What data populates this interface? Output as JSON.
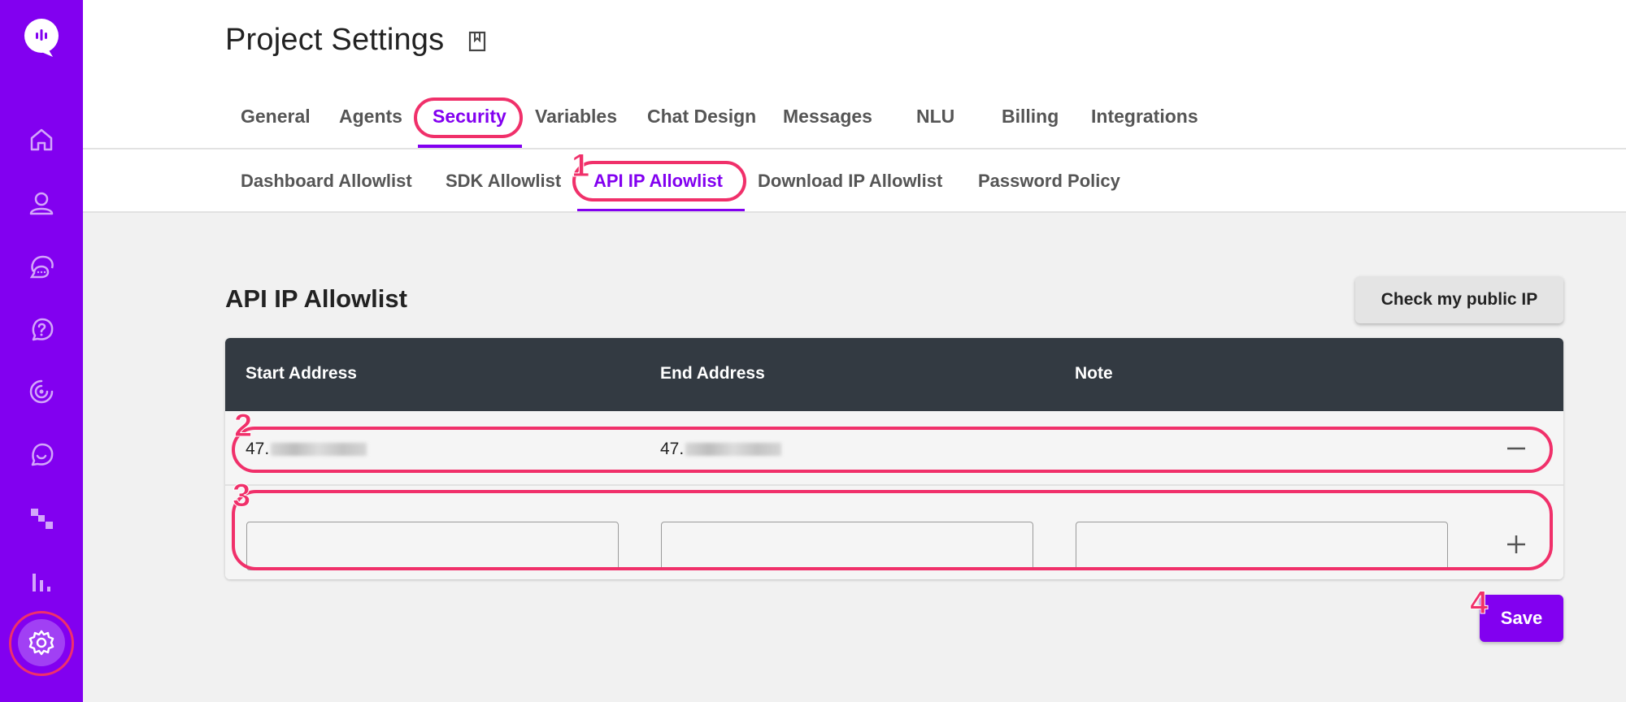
{
  "sidebar": {
    "items": [
      {
        "icon": "home-icon"
      },
      {
        "icon": "users-icon"
      },
      {
        "icon": "chat-icon"
      },
      {
        "icon": "help-icon"
      },
      {
        "icon": "target-icon"
      },
      {
        "icon": "conversation-icon"
      },
      {
        "icon": "flow-icon"
      },
      {
        "icon": "analytics-icon"
      },
      {
        "icon": "settings-icon",
        "active": true
      }
    ]
  },
  "header": {
    "title": "Project Settings",
    "tabs": [
      "General",
      "Agents",
      "Security",
      "Variables",
      "Chat Design",
      "Messages",
      "NLU",
      "Billing",
      "Integrations"
    ],
    "active_tab": "Security",
    "subtabs": [
      "Dashboard Allowlist",
      "SDK Allowlist",
      "API IP Allowlist",
      "Download IP Allowlist",
      "Password Policy"
    ],
    "active_subtab": "API IP Allowlist"
  },
  "main": {
    "section_title": "API IP Allowlist",
    "check_ip_label": "Check my public IP",
    "table": {
      "columns": [
        "Start Address",
        "End Address",
        "Note"
      ],
      "rows": [
        {
          "start": "47.",
          "end": "47.",
          "note": ""
        }
      ],
      "new_row": {
        "start": "",
        "end": "",
        "note": ""
      }
    },
    "save_label": "Save"
  },
  "annotations": [
    "1",
    "2",
    "3",
    "4"
  ],
  "colors": {
    "brand": "#8200f0",
    "annotation": "#f0306a",
    "table_header": "#333a42"
  }
}
